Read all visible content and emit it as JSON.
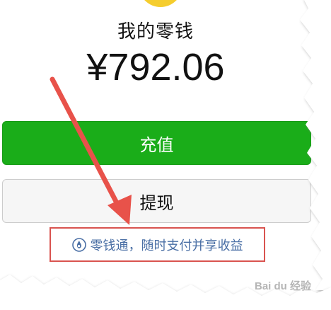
{
  "wallet": {
    "title": "我的零钱",
    "balance": "¥792.06"
  },
  "actions": {
    "recharge_label": "充值",
    "withdraw_label": "提现"
  },
  "promo": {
    "icon": "lingqiantong-drop-icon",
    "text": "零钱通，随时支付并享收益"
  },
  "colors": {
    "primary_green": "#1aad19",
    "promo_text": "#4a6fa5",
    "highlight_box": "#d9534f",
    "annotation_arrow": "#e8524a",
    "coin": "#f5cd2e"
  },
  "watermark": {
    "text": "Bai du 经验"
  }
}
